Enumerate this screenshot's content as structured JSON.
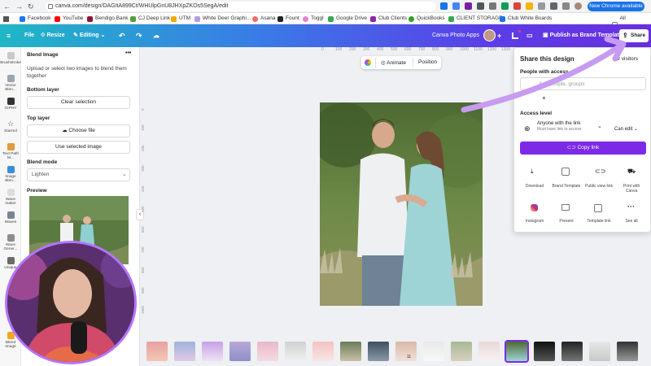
{
  "browser": {
    "url": "canva.com/design/DAGItA899Ct/WHUlpGnU8JHXpZKOs5SegA/edit",
    "chrome_available": "New Chrome available",
    "bookmarks": [
      "Facebook",
      "YouTube",
      "Bendigo Bank",
      "CJ Deep Link",
      "UTM",
      "White Deer Graphi...",
      "Asana",
      "Fount",
      "Toggl",
      "Google Drive",
      "Club Clients",
      "QuickBooks",
      "CLIENT STORAGE",
      "Club White Boards"
    ],
    "all_bookmarks": "All Bookmarks"
  },
  "toolbar": {
    "file": "File",
    "resize": "Resize",
    "editing": "Editing",
    "app_name": "Canva Photo Apps",
    "publish": "Publish as Brand Template",
    "share": "Share"
  },
  "rail": [
    "Brushstroke",
    "Vector Blen...",
    "GIPHY",
    "Starred",
    "Text Path M...",
    "Image Blen...",
    "Wave maker",
    "Waves",
    "Wave Gener...",
    "Unique",
    "",
    "Blend Image"
  ],
  "panel": {
    "title": "Blend Image",
    "more": "•••",
    "description": "Upload or select two images to blend them together",
    "bottom_layer": "Bottom layer",
    "clear_selection": "Clear selection",
    "top_layer": "Top layer",
    "choose_file": "Choose file",
    "use_selected": "Use selected image",
    "blend_mode": "Blend mode",
    "blend_value": "Lighten",
    "preview": "Preview"
  },
  "rulers": {
    "top": [
      "0",
      "100",
      "200",
      "300",
      "400",
      "500",
      "600",
      "700",
      "800",
      "900",
      "1000",
      "1100",
      "1200",
      "1300",
      "1400",
      "1500",
      "1600",
      "1700"
    ],
    "left": [
      "0",
      "100",
      "200",
      "300",
      "400",
      "500",
      "600",
      "700",
      "800",
      "900",
      "1000",
      "1100",
      "1200",
      "1300",
      "1400"
    ]
  },
  "canvas": {
    "animate": "Animate",
    "position": "Position"
  },
  "share_panel": {
    "title": "Share this design",
    "visitors": "2 visitors",
    "people_label": "People with access",
    "people_placeholder": "Add people, groups",
    "access_level": "Access level",
    "access_who": "Anyone with the link",
    "access_note": "Must have link to access",
    "access_role": "Can edit",
    "copy_link": "Copy link",
    "options": [
      "Download",
      "Brand Template",
      "Public view link",
      "Print with Canva",
      "Instagram",
      "Present",
      "Template link",
      "See all"
    ]
  },
  "filmstrip": {
    "labels": [
      "",
      "",
      "",
      "",
      "",
      "",
      "",
      "",
      "",
      "11",
      "",
      "",
      "",
      "",
      "",
      "",
      "",
      "",
      ""
    ]
  },
  "colors": {
    "accent": "#7d2ae8",
    "gradient_start": "#1fb7c6",
    "gradient_end": "#6a2fe0",
    "arrow": "#c79bf2"
  }
}
